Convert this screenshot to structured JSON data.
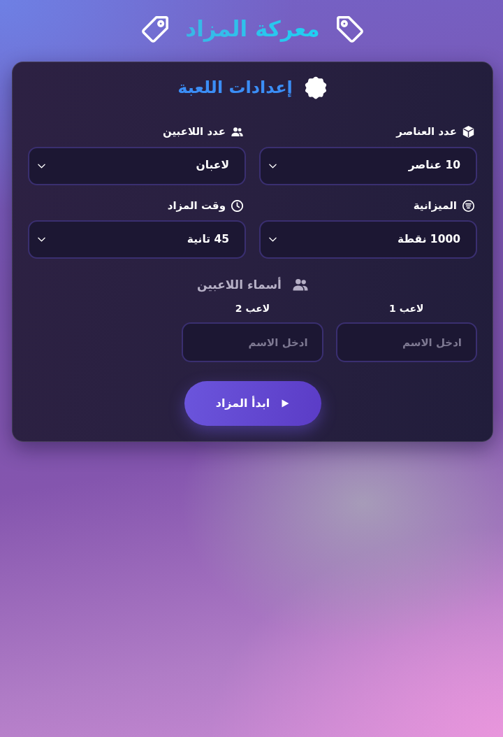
{
  "header": {
    "title": "معركة المزاد"
  },
  "settings": {
    "title": "إعدادات اللعبة",
    "fields": [
      {
        "label": "عدد العناصر",
        "value": "10 عناصر"
      },
      {
        "label": "عدد اللاعبين",
        "value": "لاعبان"
      },
      {
        "label": "الميزانية",
        "value": "1000 نقطة"
      },
      {
        "label": "وقت المزاد",
        "value": "45 تانية"
      }
    ]
  },
  "players": {
    "title": "أسماء اللاعبين",
    "items": [
      {
        "label": "لاعب 1",
        "placeholder": "ادخل الاسم"
      },
      {
        "label": "لاعب 2",
        "placeholder": "ادخل الاسم"
      }
    ]
  },
  "start_button": {
    "label": "ابدأ المزاد"
  }
}
